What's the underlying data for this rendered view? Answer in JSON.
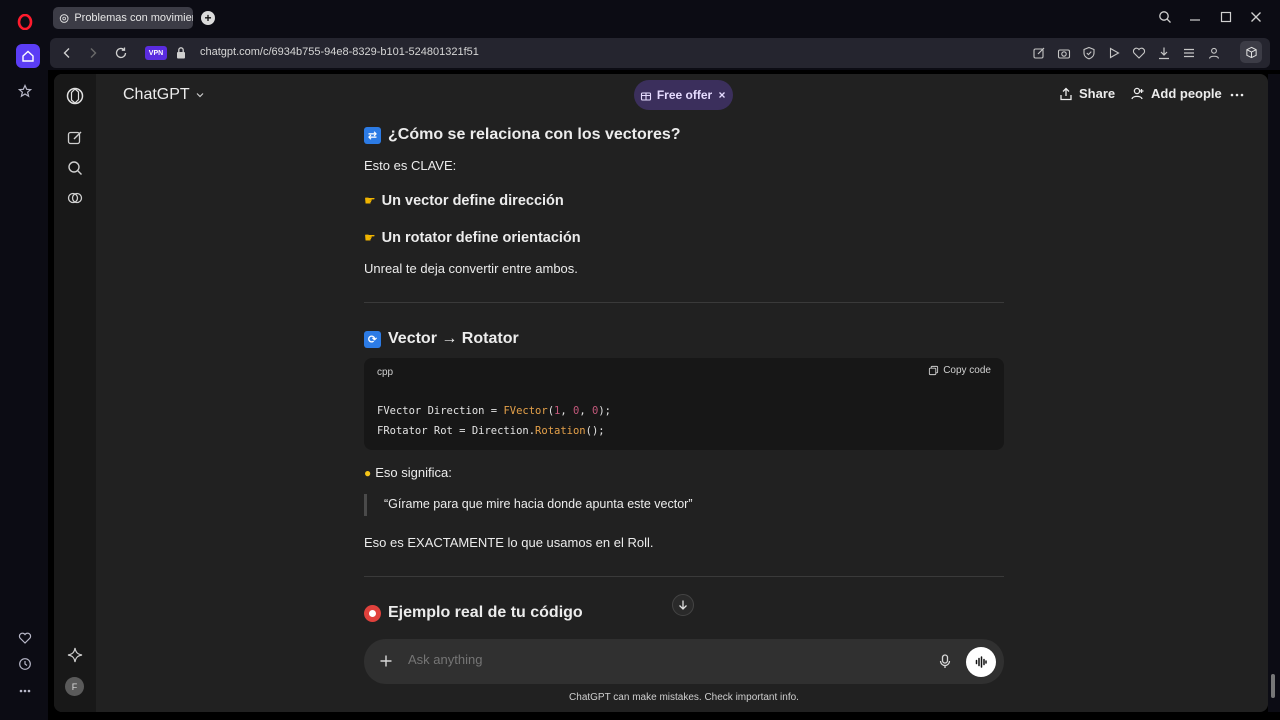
{
  "browser": {
    "tab_title": "Problemas con movimient",
    "url": "chatgpt.com/c/6934b755-94e8-8329-b101-524801321f51",
    "vpn_label": "VPN"
  },
  "header": {
    "model": "ChatGPT",
    "free_offer": "Free offer",
    "share": "Share",
    "add_people": "Add people"
  },
  "chat": {
    "h_vectors": "¿Cómo se relaciona con los vectores?",
    "clave": "Esto es CLAVE:",
    "bullet1": "Un vector define dirección",
    "bullet2": "Un rotator define orientación",
    "convert": "Unreal te deja convertir entre ambos.",
    "h_vector_rotator": "Vector → Rotator",
    "code": {
      "lang": "cpp",
      "copy": "Copy code"
    },
    "significa": "Eso significa:",
    "quote": "“Gírame para que mire hacia donde apunta este vector”",
    "exactamente": "Eso es EXACTAMENTE lo que usamos en el Roll.",
    "h_example": "Ejemplo real de tu código"
  },
  "composer": {
    "placeholder": "Ask anything"
  },
  "footer": {
    "disclaimer": "ChatGPT can make mistakes. Check important info."
  },
  "user": {
    "initial": "F"
  },
  "colors": {
    "page_bg": "#212121",
    "accent_offer": "#3b2f5c",
    "opera_red": "#ff1b2d"
  }
}
